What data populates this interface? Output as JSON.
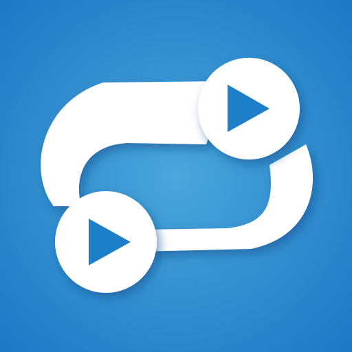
{
  "icon": {
    "semantic": "repeat-video-icon",
    "colors": {
      "background_center": "#4aa6db",
      "background_edge": "#1c78c4",
      "foreground": "#ffffff",
      "play_triangle": "#1f7fc8",
      "shadow": "#0b4f8a"
    }
  }
}
